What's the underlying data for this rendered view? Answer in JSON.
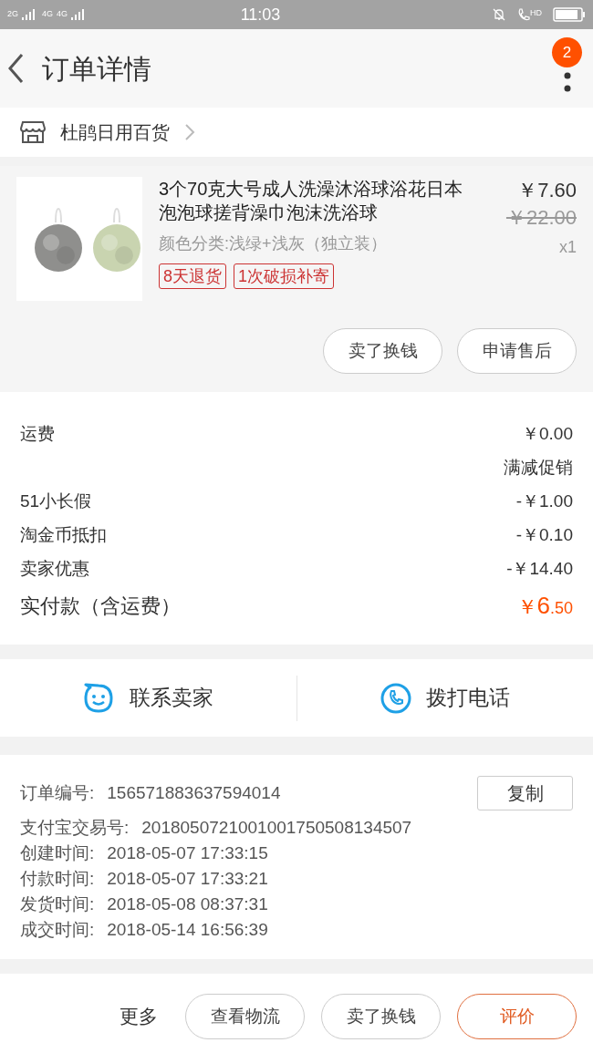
{
  "status_bar": {
    "signal_1": "2G",
    "signal_2": "4G",
    "signal_3": "4G",
    "time": "11:03",
    "call_label": "HD"
  },
  "header": {
    "title": "订单详情",
    "badge": "2"
  },
  "store": {
    "name": "杜鹃日用百货"
  },
  "product": {
    "title": "3个70克大号成人洗澡沐浴球浴花日本泡泡球搓背澡巾泡沫洗浴球",
    "variant": "颜色分类:浅绿+浅灰（独立装）",
    "price": "￥7.60",
    "original_price": "￥22.00",
    "quantity": "x1",
    "tags": [
      "8天退货",
      "1次破损补寄"
    ],
    "actions": [
      "卖了换钱",
      "申请售后"
    ]
  },
  "costs": [
    {
      "label": "运费",
      "value": "￥0.00"
    },
    {
      "value": "满减促销"
    },
    {
      "label": "51小长假",
      "value": "-￥1.00"
    },
    {
      "label": "淘金币抵扣",
      "value": "-￥0.10"
    },
    {
      "label": "卖家优惠",
      "value": "-￥14.40"
    }
  ],
  "total": {
    "label": "实付款（含运费）",
    "currency": "￥",
    "integer": "6",
    "decimal": ".50"
  },
  "contact": {
    "seller": "联系卖家",
    "phone": "拨打电话"
  },
  "order_info": {
    "copy_button": "复制",
    "rows": [
      {
        "label": "订单编号:",
        "value": "156571883637594014"
      },
      {
        "label": "支付宝交易号:",
        "value": "2018050721001001750508134507"
      },
      {
        "label": "创建时间:",
        "value": "2018-05-07 17:33:15"
      },
      {
        "label": "付款时间:",
        "value": "2018-05-07 17:33:21"
      },
      {
        "label": "发货时间:",
        "value": "2018-05-08 08:37:31"
      },
      {
        "label": "成交时间:",
        "value": "2018-05-14 16:56:39"
      }
    ]
  },
  "bottom_bar": {
    "more": "更多",
    "buttons": [
      {
        "label": "查看物流",
        "kind": "plain"
      },
      {
        "label": "卖了换钱",
        "kind": "plain"
      },
      {
        "label": "评价",
        "kind": "primary"
      }
    ]
  }
}
